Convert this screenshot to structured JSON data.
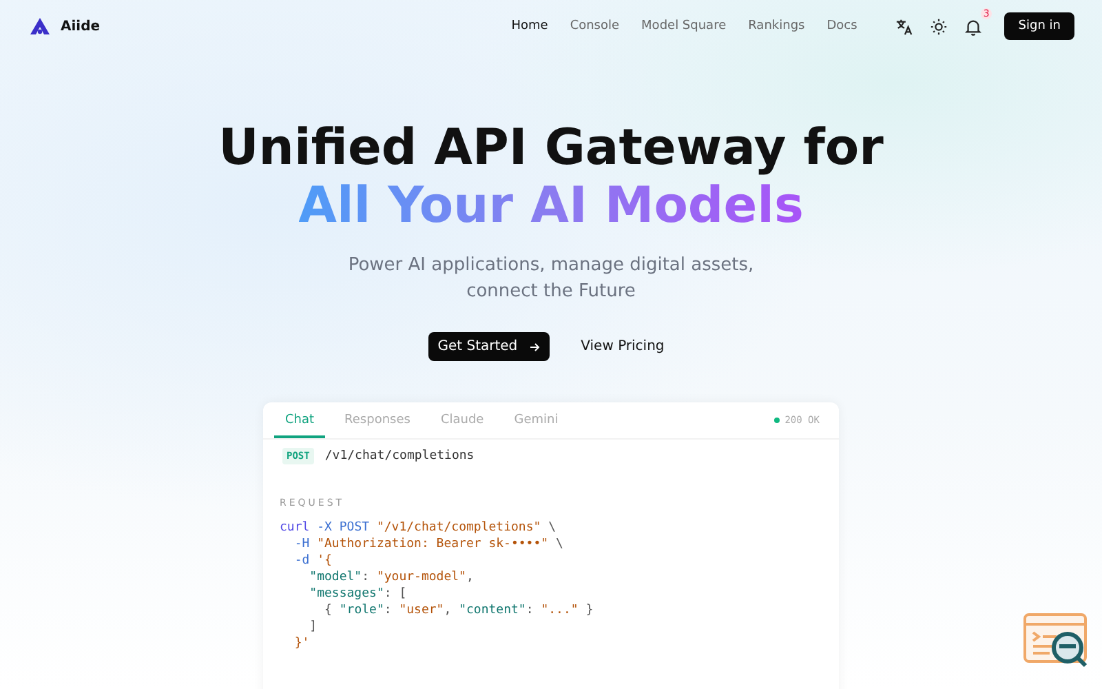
{
  "brand": {
    "name": "Aiide"
  },
  "nav": [
    {
      "label": "Home",
      "selected": true
    },
    {
      "label": "Console",
      "selected": false
    },
    {
      "label": "Model Square",
      "selected": false
    },
    {
      "label": "Rankings",
      "selected": false
    },
    {
      "label": "Docs",
      "selected": false
    }
  ],
  "notifications": {
    "count": "3"
  },
  "sign_in": "Sign in",
  "hero": {
    "title_line1": "Unified API Gateway for",
    "title_line2": "All Your AI Models",
    "subtitle": "Power AI applications, manage digital assets, connect the Future",
    "primary_button": "Get Started",
    "secondary_button": "View Pricing"
  },
  "code_card": {
    "tabs": [
      {
        "label": "Chat",
        "selected": true
      },
      {
        "label": "Responses",
        "selected": false
      },
      {
        "label": "Claude",
        "selected": false
      },
      {
        "label": "Gemini",
        "selected": false
      }
    ],
    "status": {
      "text": "200 OK",
      "color": "#10b981"
    },
    "method": "POST",
    "endpoint": "/v1/chat/completions",
    "section_label": "REQUEST",
    "code_lines": [
      [
        {
          "kind": "cmd",
          "text": "curl"
        },
        {
          "kind": "flag",
          "text": " -X POST "
        },
        {
          "kind": "string",
          "text": "\"/v1/chat/completions\""
        },
        {
          "kind": "plain",
          "text": " \\"
        }
      ],
      [
        {
          "kind": "flag",
          "text": "  -H "
        },
        {
          "kind": "string",
          "text": "\"Authorization: Bearer sk-••••\""
        },
        {
          "kind": "plain",
          "text": " \\"
        }
      ],
      [
        {
          "kind": "flag",
          "text": "  -d "
        },
        {
          "kind": "string",
          "text": "'{"
        }
      ],
      [
        {
          "kind": "key",
          "text": "    \"model\""
        },
        {
          "kind": "plain",
          "text": ": "
        },
        {
          "kind": "string",
          "text": "\"your-model\""
        },
        {
          "kind": "plain",
          "text": ","
        }
      ],
      [
        {
          "kind": "key",
          "text": "    \"messages\""
        },
        {
          "kind": "plain",
          "text": ": ["
        }
      ],
      [
        {
          "kind": "plain",
          "text": "      { "
        },
        {
          "kind": "key",
          "text": "\"role\""
        },
        {
          "kind": "plain",
          "text": ": "
        },
        {
          "kind": "string",
          "text": "\"user\""
        },
        {
          "kind": "plain",
          "text": ", "
        },
        {
          "kind": "key",
          "text": "\"content\""
        },
        {
          "kind": "plain",
          "text": ": "
        },
        {
          "kind": "string",
          "text": "\"...\""
        },
        {
          "kind": "plain",
          "text": " }"
        }
      ],
      [
        {
          "kind": "plain",
          "text": "    ]"
        }
      ],
      [
        {
          "kind": "string",
          "text": "  }'"
        }
      ]
    ]
  }
}
